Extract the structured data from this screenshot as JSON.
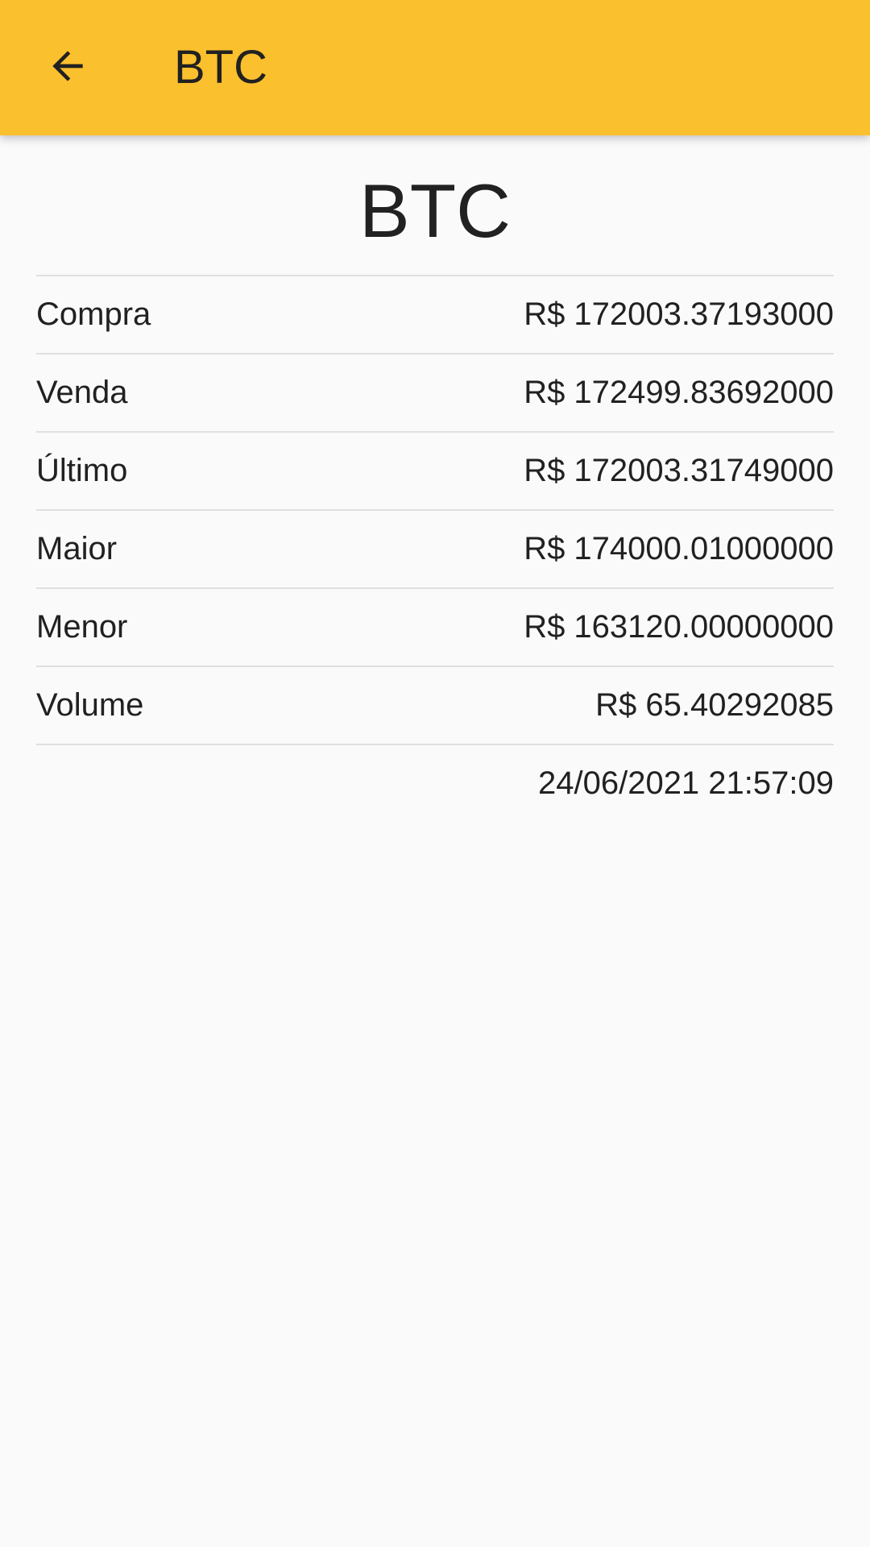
{
  "app_bar": {
    "title": "BTC",
    "back_icon": "arrow-back-icon",
    "background": "#fbc02d"
  },
  "main": {
    "heading": "BTC",
    "rows": [
      {
        "label": "Compra",
        "value": "R$ 172003.37193000"
      },
      {
        "label": "Venda",
        "value": "R$ 172499.83692000"
      },
      {
        "label": "Último",
        "value": "R$ 172003.31749000"
      },
      {
        "label": "Maior",
        "value": "R$ 174000.01000000"
      },
      {
        "label": "Menor",
        "value": "R$ 163120.00000000"
      },
      {
        "label": "Volume",
        "value": "R$ 65.40292085"
      }
    ],
    "timestamp": "24/06/2021 21:57:09"
  }
}
